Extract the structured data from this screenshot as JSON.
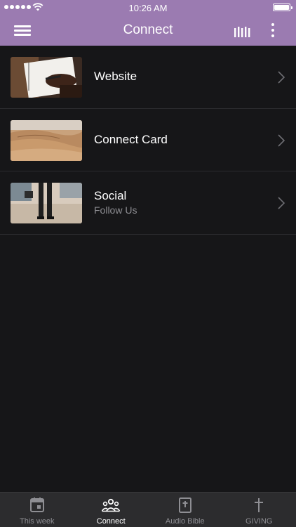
{
  "status_bar": {
    "time": "10:26 AM"
  },
  "header": {
    "title": "Connect"
  },
  "list": {
    "items": [
      {
        "title": "Website",
        "subtitle": ""
      },
      {
        "title": "Connect Card",
        "subtitle": ""
      },
      {
        "title": "Social",
        "subtitle": "Follow Us"
      }
    ]
  },
  "tabs": [
    {
      "label": "This week",
      "icon": "calendar-icon",
      "active": false
    },
    {
      "label": "Connect",
      "icon": "people-icon",
      "active": true
    },
    {
      "label": "Audio Bible",
      "icon": "bible-icon",
      "active": false
    },
    {
      "label": "GIVING",
      "icon": "cross-icon",
      "active": false
    }
  ],
  "colors": {
    "header": "#9b7bb1",
    "background": "#161618",
    "tabbar": "#2c2c2e",
    "inactive_tab": "#8e8e93"
  }
}
